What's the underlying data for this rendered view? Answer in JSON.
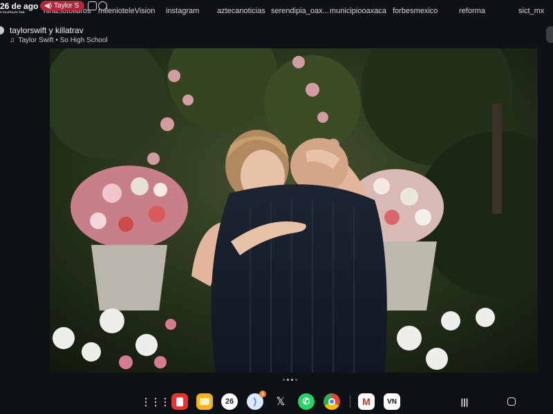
{
  "status": {
    "date": "26 de ago",
    "media_pill": "Taylor S"
  },
  "tabs": [
    "historia",
    "nina.fotolibros",
    "milenioteleVision",
    "instagram",
    "aztecanoticias",
    "serendipia_oax...",
    "municipiooaxaca",
    "forbesmexico",
    "reforma",
    "sict_mx"
  ],
  "story": {
    "user": "taylorswift y killatrav",
    "song": "Taylor Swift • So High School",
    "pages": 4,
    "active_page": 2
  },
  "dock": {
    "apps": [
      {
        "name": "apps-grid-icon"
      },
      {
        "name": "red-notes-app-icon",
        "color": "#e8332e"
      },
      {
        "name": "files-app-icon",
        "color": "#f2b31c"
      },
      {
        "name": "calendar-app-icon",
        "label": "26",
        "color": "#ffffff"
      },
      {
        "name": "messages-app-icon",
        "badge": "1",
        "color": "#3b8ef0"
      },
      {
        "name": "x-app-icon"
      },
      {
        "name": "whatsapp-app-icon",
        "color": "#25d366"
      },
      {
        "name": "chrome-app-icon"
      },
      {
        "name": "gmail-app-icon",
        "label": "M"
      },
      {
        "name": "vn-app-icon",
        "label": "VN"
      }
    ]
  }
}
